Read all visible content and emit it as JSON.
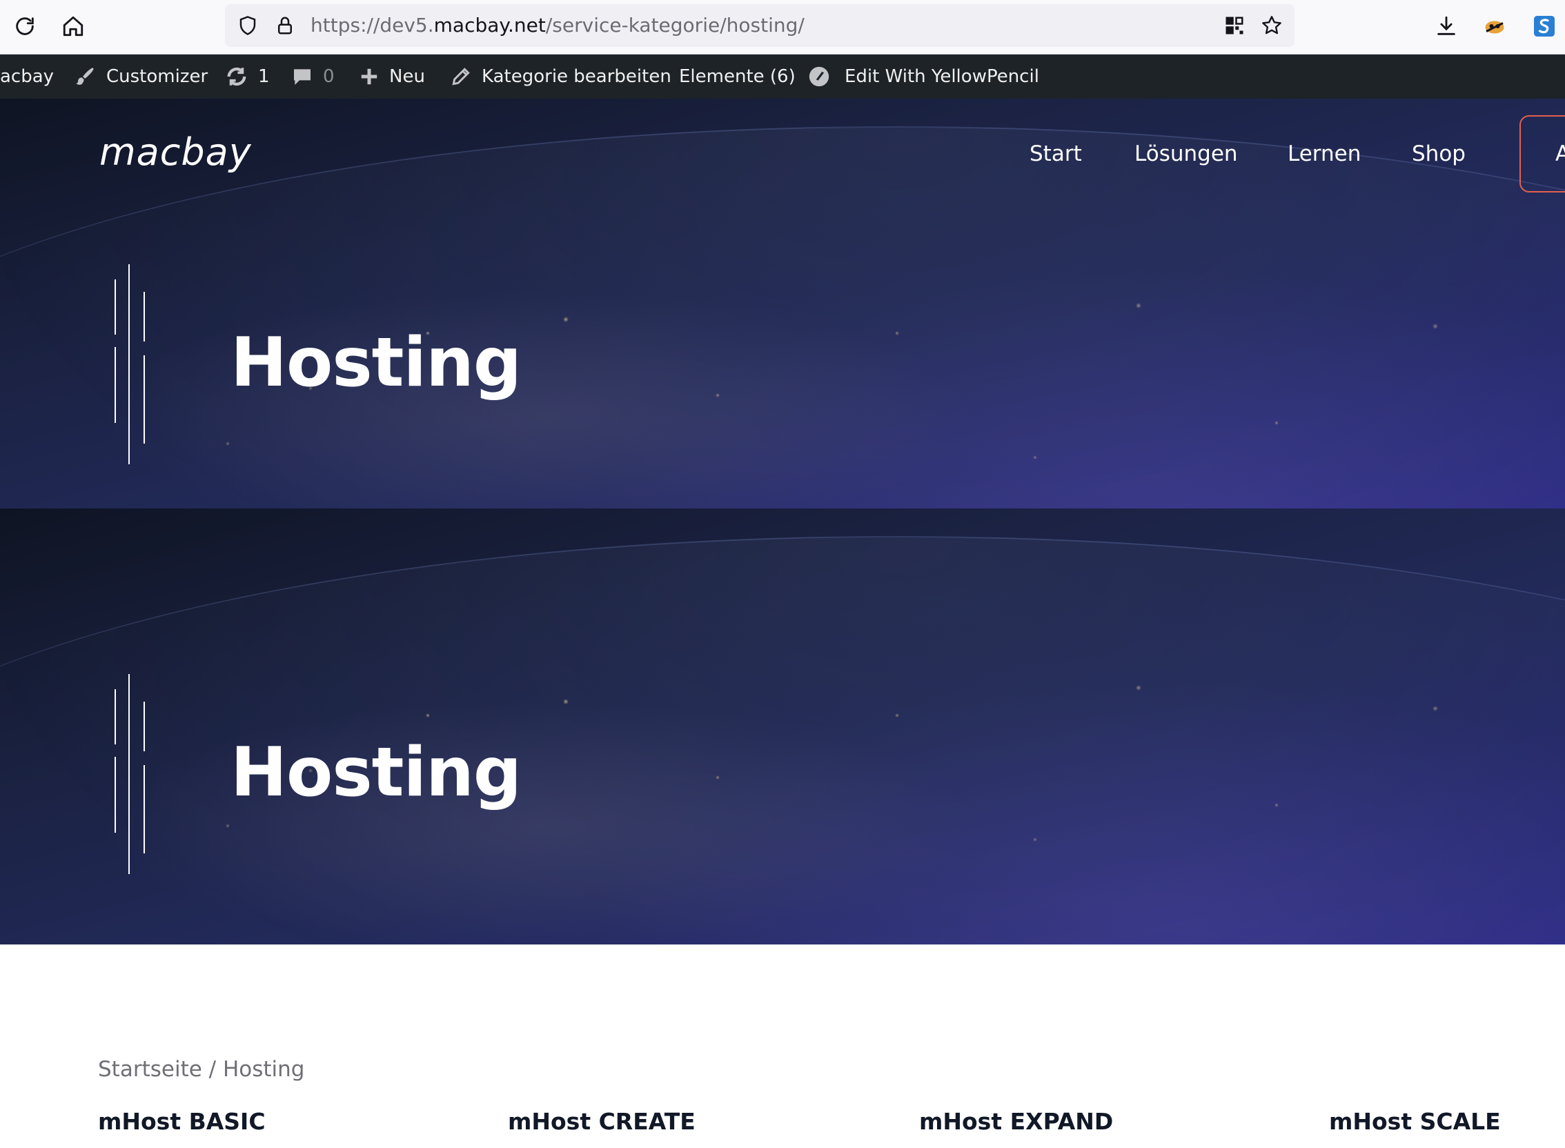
{
  "browser": {
    "url_prefix": "https://dev5.",
    "url_host": "macbay.net",
    "url_path": "/service-kategorie/hosting/"
  },
  "admin_bar": {
    "site": "acbay",
    "customizer": "Customizer",
    "updates_count": "1",
    "comments_count": "0",
    "new": "Neu",
    "edit_category": "Kategorie bearbeiten",
    "elements": "Elemente (6)",
    "yellowpencil": "Edit With YellowPencil"
  },
  "site_nav": {
    "logo": "macbay",
    "links": [
      "Start",
      "Lösungen",
      "Lernen",
      "Shop"
    ],
    "cta_partial": "A",
    "cta_border_color": "#e2604e"
  },
  "hero_sections": [
    {
      "title": "Hosting"
    },
    {
      "title": "Hosting"
    }
  ],
  "breadcrumb": {
    "home": "Startseite",
    "separator": " / ",
    "current": "Hosting"
  },
  "products": [
    "mHost BASIC",
    "mHost CREATE",
    "mHost EXPAND",
    "mHost SCALE"
  ]
}
